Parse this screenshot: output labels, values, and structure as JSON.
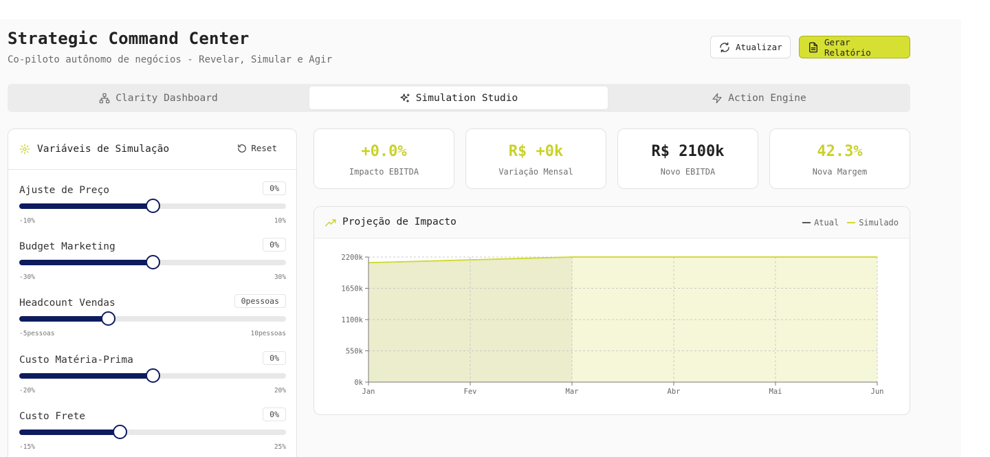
{
  "header": {
    "title": "Strategic Command Center",
    "subtitle": "Co-piloto autônomo de negócios - Revelar, Simular e Agir",
    "refresh_label": "Atualizar",
    "report_label": "Gerar Relatório"
  },
  "tabs": [
    {
      "label": "Clarity Dashboard",
      "icon": "network-icon",
      "active": false
    },
    {
      "label": "Simulation Studio",
      "icon": "sparkles-icon",
      "active": true
    },
    {
      "label": "Action Engine",
      "icon": "lightning-icon",
      "active": false
    }
  ],
  "simulation": {
    "title": "Variáveis de Simulação",
    "reset_label": "Reset",
    "sliders": [
      {
        "label": "Ajuste de Preço",
        "value": "0%",
        "min": "-10%",
        "max": "10%",
        "fraction": 0.5
      },
      {
        "label": "Budget Marketing",
        "value": "0%",
        "min": "-30%",
        "max": "30%",
        "fraction": 0.5
      },
      {
        "label": "Headcount Vendas",
        "value": "0pessoas",
        "min": "-5pessoas",
        "max": "10pessoas",
        "fraction": 0.3333
      },
      {
        "label": "Custo Matéria-Prima",
        "value": "0%",
        "min": "-20%",
        "max": "20%",
        "fraction": 0.5
      },
      {
        "label": "Custo Frete",
        "value": "0%",
        "min": "-15%",
        "max": "25%",
        "fraction": 0.375
      }
    ]
  },
  "kpis": [
    {
      "value": "+0.0%",
      "label": "Impacto EBITDA",
      "color": "#c9d22a"
    },
    {
      "value": "R$ +0k",
      "label": "Variação Mensal",
      "color": "#c9d22a"
    },
    {
      "value": "R$ 2100k",
      "label": "Novo EBITDA",
      "color": "#222222"
    },
    {
      "value": "42.3%",
      "label": "Nova Margem",
      "color": "#c9d22a"
    }
  ],
  "chart": {
    "title": "Projeção de Impacto",
    "legend": [
      {
        "label": "Atual",
        "color": "#555555"
      },
      {
        "label": "Simulado",
        "color": "#cfd82e"
      }
    ]
  },
  "chart_data": {
    "type": "area",
    "categories": [
      "Jan",
      "Fev",
      "Mar",
      "Abr",
      "Mai",
      "Jun"
    ],
    "series": [
      {
        "name": "Atual",
        "values": [
          2100,
          2150,
          2200,
          2200,
          2200,
          2200
        ]
      },
      {
        "name": "Simulado",
        "values": [
          2100,
          2150,
          2200,
          2200,
          2200,
          2200
        ]
      }
    ],
    "ylim": [
      0,
      2200
    ],
    "yticks": [
      0,
      550,
      1100,
      1650,
      2200
    ],
    "ytick_labels": [
      "0k",
      "550k",
      "1100k",
      "1650k",
      "2200k"
    ],
    "grid": true
  },
  "colors": {
    "accent": "#d6e032",
    "slider": "#0e1b5e"
  }
}
